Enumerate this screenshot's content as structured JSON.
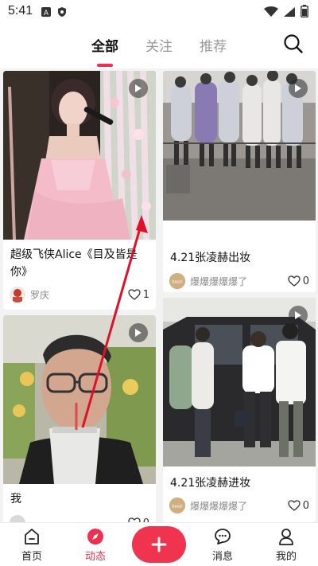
{
  "status_bar": {
    "time": "5:41"
  },
  "top_tabs": [
    {
      "label": "全部",
      "active": true
    },
    {
      "label": "关注",
      "active": false
    },
    {
      "label": "推荐",
      "active": false
    }
  ],
  "feed": {
    "cards": [
      {
        "title": "超级飞侠Alice《目及皆是你》",
        "author": "罗庆",
        "likes": "1",
        "image": "woman-singer-pink-dress"
      },
      {
        "title": "4.21张凌赫出妆",
        "author": "爆爆爆爆爆了",
        "likes": "0",
        "image": "crowd-with-phones"
      },
      {
        "title": "我",
        "author": "",
        "likes": "0",
        "image": "man-with-glasses-drink"
      },
      {
        "title": "4.21张凌赫进妆",
        "author": "爆爆爆爆爆了",
        "likes": "0",
        "image": "people-by-van"
      }
    ]
  },
  "bottom_nav": {
    "items": [
      {
        "label": "首页",
        "icon": "home-icon"
      },
      {
        "label": "动态",
        "icon": "compass-icon",
        "active": true
      },
      {
        "label": "消息",
        "icon": "message-icon"
      },
      {
        "label": "我的",
        "icon": "profile-icon"
      }
    ],
    "fab_icon": "plus-icon"
  },
  "colors": {
    "accent": "#ee2f4f",
    "fab": "#f0334f",
    "background": "#f3f3f3"
  }
}
